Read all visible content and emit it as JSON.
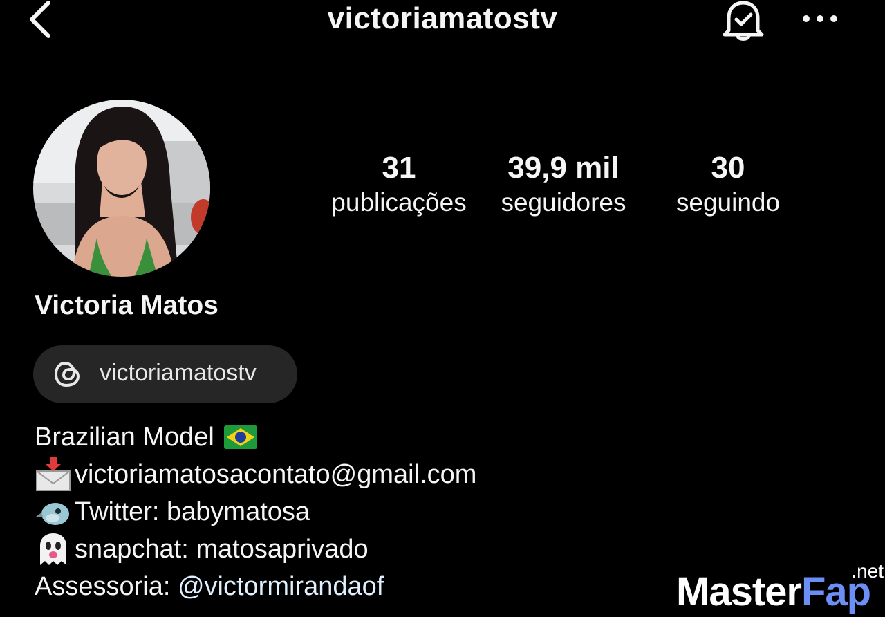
{
  "header": {
    "username": "victoriamatostv",
    "back_icon": "chevron-left-icon",
    "bell_icon": "bell-check-icon",
    "more_icon": "more-horizontal-icon"
  },
  "stats": {
    "posts_count": "31",
    "posts_label": "publicações",
    "followers_count": "39,9 mil",
    "followers_label": "seguidores",
    "following_count": "30",
    "following_label": "seguindo"
  },
  "profile": {
    "display_name": "Victoria Matos",
    "threads_handle": "victoriamatostv",
    "threads_icon": "threads-icon"
  },
  "bio": {
    "line1": "Brazilian Model",
    "line2": "victoriamatosacontato@gmail.com",
    "line3": "Twitter: babymatosa",
    "line4": "snapchat: matosaprivado",
    "line5_prefix": "Assessoria: ",
    "line5_mention": "@victormirandaof"
  },
  "watermark": {
    "brand_part1": "Master",
    "brand_part2": "Fap",
    "suffix": ".net"
  },
  "colors": {
    "background": "#000000",
    "pill": "#262626",
    "mention": "#e0f0ff",
    "watermark_accent": "#6c8ff6"
  }
}
